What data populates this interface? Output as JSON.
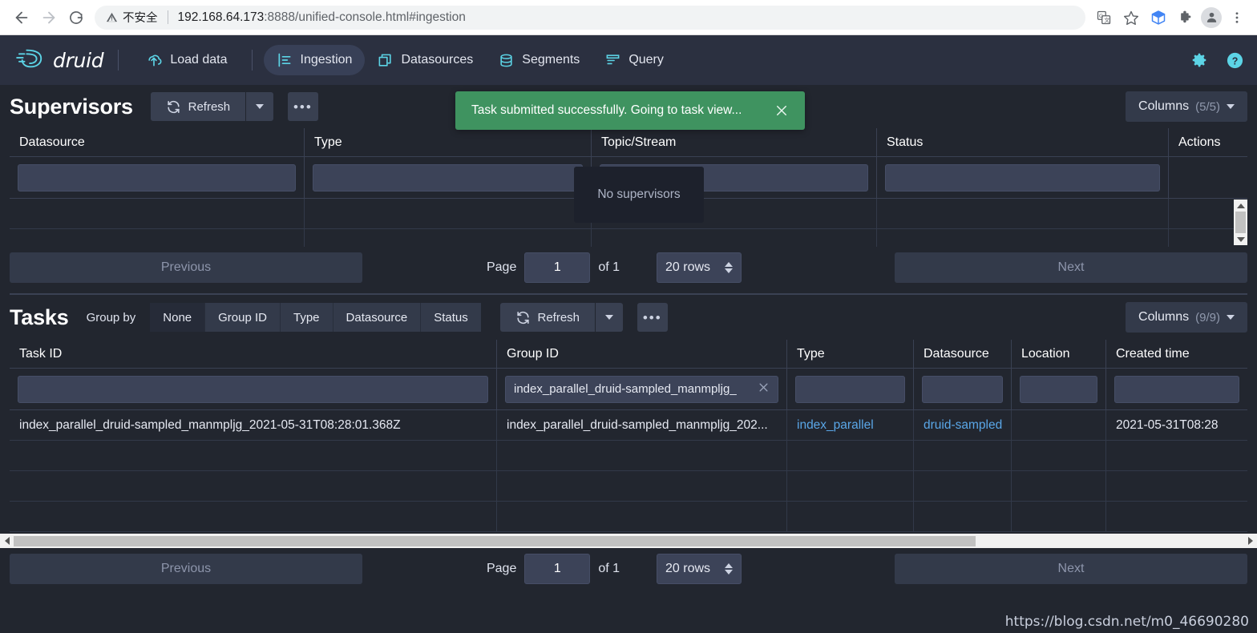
{
  "browser": {
    "back_icon": "arrow-left-icon",
    "forward_icon": "arrow-right-icon",
    "reload_icon": "reload-icon",
    "security_warning": "不安全",
    "url_host": "192.168.64.173",
    "url_rest": ":8888/unified-console.html#ingestion",
    "translate_icon": "translate-icon",
    "bookmark_icon": "star-icon",
    "collections_icon": "collections-icon",
    "extensions_icon": "puzzle-icon",
    "profile_icon": "avatar-icon",
    "menu_icon": "three-dot-menu-icon"
  },
  "header": {
    "brand": "druid",
    "brand_icon": "druid-logo-icon",
    "nav": [
      {
        "label": "Load data",
        "icon": "upload-cloud-icon",
        "active": false
      },
      {
        "label": "Ingestion",
        "icon": "ingestion-icon",
        "active": true
      },
      {
        "label": "Datasources",
        "icon": "datasources-icon",
        "active": false
      },
      {
        "label": "Segments",
        "icon": "segments-icon",
        "active": false
      },
      {
        "label": "Query",
        "icon": "query-icon",
        "active": false
      }
    ],
    "settings_icon": "gear-icon",
    "help_icon": "help-icon"
  },
  "toast": {
    "message": "Task submitted successfully. Going to task view...",
    "close_icon": "close-icon",
    "color": "#3f9360"
  },
  "supervisors": {
    "title": "Supervisors",
    "refresh_label": "Refresh",
    "refresh_icon": "refresh-icon",
    "caret_icon": "chevron-down-icon",
    "more_label": "•••",
    "columns_label": "Columns",
    "columns_count": "(5/5)",
    "headers": [
      "Datasource",
      "Type",
      "Topic/Stream",
      "Status",
      "Actions"
    ],
    "filters": [
      "",
      "",
      "",
      "",
      ""
    ],
    "empty_message": "No supervisors",
    "pagination": {
      "previous": "Previous",
      "page_label": "Page",
      "page_value": "1",
      "of_label": "of 1",
      "rows_value": "20 rows",
      "next": "Next"
    }
  },
  "tasks": {
    "title": "Tasks",
    "group_by_label": "Group by",
    "group_by_options": [
      {
        "label": "None",
        "selected": true
      },
      {
        "label": "Group ID",
        "selected": false
      },
      {
        "label": "Type",
        "selected": false
      },
      {
        "label": "Datasource",
        "selected": false
      },
      {
        "label": "Status",
        "selected": false
      }
    ],
    "refresh_label": "Refresh",
    "refresh_icon": "refresh-icon",
    "caret_icon": "chevron-down-icon",
    "more_label": "•••",
    "columns_label": "Columns",
    "columns_count": "(9/9)",
    "headers": [
      "Task ID",
      "Group ID",
      "Type",
      "Datasource",
      "Location",
      "Created time"
    ],
    "filters": {
      "task_id": "",
      "group_id": "index_parallel_druid-sampled_manmpljg_",
      "group_id_clear_icon": "close-icon",
      "type": "",
      "datasource": "",
      "location": "",
      "created_time": ""
    },
    "rows": [
      {
        "task_id": "index_parallel_druid-sampled_manmpljg_2021-05-31T08:28:01.368Z",
        "group_id": "index_parallel_druid-sampled_manmpljg_202...",
        "type": "index_parallel",
        "datasource": "druid-sampled",
        "location": "",
        "created_time": "2021-05-31T08:28"
      }
    ],
    "pagination": {
      "previous": "Previous",
      "page_label": "Page",
      "page_value": "1",
      "of_label": "of 1",
      "rows_value": "20 rows",
      "next": "Next"
    }
  },
  "watermark": "https://blog.csdn.net/m0_46690280"
}
